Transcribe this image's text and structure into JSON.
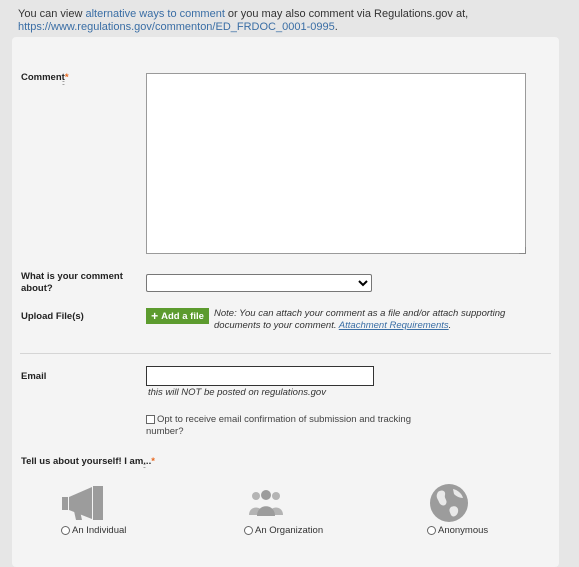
{
  "intro": {
    "prefix": "You can view ",
    "alt_link": "alternative ways to comment",
    "middle": " or you may also comment via Regulations.gov at,",
    "url_link": "https://www.regulations.gov/commenton/ED_FRDOC_0001-0995",
    "suffix": "."
  },
  "form": {
    "comment_label": "Comment",
    "required_mark": "*",
    "required_dots": "::",
    "about_label": "What is your comment about?",
    "about_selected": "",
    "upload_label": "Upload File(s)",
    "add_file_label": "Add a file",
    "note_text": "Note: You can attach your comment as a file and/or attach supporting documents to your comment. ",
    "note_link": "Attachment Requirements",
    "note_suffix": ".",
    "email_label": "Email",
    "email_value": "",
    "email_hint": "this will NOT be posted on regulations.gov",
    "optin_label": "Opt to receive email confirmation of submission and tracking number?",
    "about_you_label": "Tell us about yourself! I am..."
  },
  "choices": [
    {
      "label": "An Individual",
      "icon": "megaphone-icon"
    },
    {
      "label": "An Organization",
      "icon": "group-icon"
    },
    {
      "label": "Anonymous",
      "icon": "globe-icon"
    }
  ],
  "colors": {
    "link": "#3a6ea5",
    "required": "#e8681f",
    "add_button": "#5c9b2e",
    "icon_gray": "#9c9c9c"
  }
}
